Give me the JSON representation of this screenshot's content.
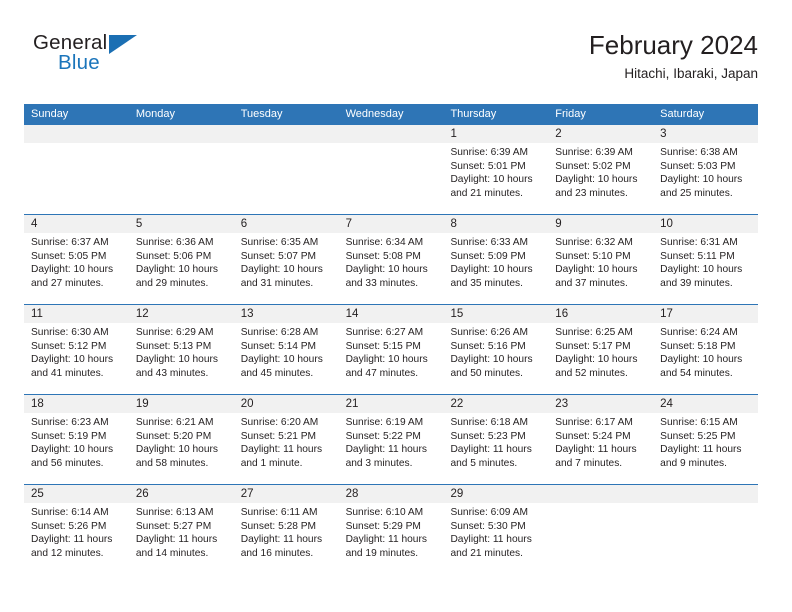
{
  "brand": {
    "name_part1": "General",
    "name_part2": "Blue"
  },
  "header": {
    "title": "February 2024",
    "location": "Hitachi, Ibaraki, Japan"
  },
  "colors": {
    "header_blue": "#2e75b6",
    "brand_blue": "#1b75bb",
    "numrow_gray": "#f1f1f1",
    "text": "#231f20"
  },
  "weekdays": [
    "Sunday",
    "Monday",
    "Tuesday",
    "Wednesday",
    "Thursday",
    "Friday",
    "Saturday"
  ],
  "weeks": [
    {
      "days": [
        {
          "num": "",
          "lines": [
            "",
            "",
            "",
            ""
          ]
        },
        {
          "num": "",
          "lines": [
            "",
            "",
            "",
            ""
          ]
        },
        {
          "num": "",
          "lines": [
            "",
            "",
            "",
            ""
          ]
        },
        {
          "num": "",
          "lines": [
            "",
            "",
            "",
            ""
          ]
        },
        {
          "num": "1",
          "lines": [
            "Sunrise: 6:39 AM",
            "Sunset: 5:01 PM",
            "Daylight: 10 hours",
            "and 21 minutes."
          ]
        },
        {
          "num": "2",
          "lines": [
            "Sunrise: 6:39 AM",
            "Sunset: 5:02 PM",
            "Daylight: 10 hours",
            "and 23 minutes."
          ]
        },
        {
          "num": "3",
          "lines": [
            "Sunrise: 6:38 AM",
            "Sunset: 5:03 PM",
            "Daylight: 10 hours",
            "and 25 minutes."
          ]
        }
      ]
    },
    {
      "days": [
        {
          "num": "4",
          "lines": [
            "Sunrise: 6:37 AM",
            "Sunset: 5:05 PM",
            "Daylight: 10 hours",
            "and 27 minutes."
          ]
        },
        {
          "num": "5",
          "lines": [
            "Sunrise: 6:36 AM",
            "Sunset: 5:06 PM",
            "Daylight: 10 hours",
            "and 29 minutes."
          ]
        },
        {
          "num": "6",
          "lines": [
            "Sunrise: 6:35 AM",
            "Sunset: 5:07 PM",
            "Daylight: 10 hours",
            "and 31 minutes."
          ]
        },
        {
          "num": "7",
          "lines": [
            "Sunrise: 6:34 AM",
            "Sunset: 5:08 PM",
            "Daylight: 10 hours",
            "and 33 minutes."
          ]
        },
        {
          "num": "8",
          "lines": [
            "Sunrise: 6:33 AM",
            "Sunset: 5:09 PM",
            "Daylight: 10 hours",
            "and 35 minutes."
          ]
        },
        {
          "num": "9",
          "lines": [
            "Sunrise: 6:32 AM",
            "Sunset: 5:10 PM",
            "Daylight: 10 hours",
            "and 37 minutes."
          ]
        },
        {
          "num": "10",
          "lines": [
            "Sunrise: 6:31 AM",
            "Sunset: 5:11 PM",
            "Daylight: 10 hours",
            "and 39 minutes."
          ]
        }
      ]
    },
    {
      "days": [
        {
          "num": "11",
          "lines": [
            "Sunrise: 6:30 AM",
            "Sunset: 5:12 PM",
            "Daylight: 10 hours",
            "and 41 minutes."
          ]
        },
        {
          "num": "12",
          "lines": [
            "Sunrise: 6:29 AM",
            "Sunset: 5:13 PM",
            "Daylight: 10 hours",
            "and 43 minutes."
          ]
        },
        {
          "num": "13",
          "lines": [
            "Sunrise: 6:28 AM",
            "Sunset: 5:14 PM",
            "Daylight: 10 hours",
            "and 45 minutes."
          ]
        },
        {
          "num": "14",
          "lines": [
            "Sunrise: 6:27 AM",
            "Sunset: 5:15 PM",
            "Daylight: 10 hours",
            "and 47 minutes."
          ]
        },
        {
          "num": "15",
          "lines": [
            "Sunrise: 6:26 AM",
            "Sunset: 5:16 PM",
            "Daylight: 10 hours",
            "and 50 minutes."
          ]
        },
        {
          "num": "16",
          "lines": [
            "Sunrise: 6:25 AM",
            "Sunset: 5:17 PM",
            "Daylight: 10 hours",
            "and 52 minutes."
          ]
        },
        {
          "num": "17",
          "lines": [
            "Sunrise: 6:24 AM",
            "Sunset: 5:18 PM",
            "Daylight: 10 hours",
            "and 54 minutes."
          ]
        }
      ]
    },
    {
      "days": [
        {
          "num": "18",
          "lines": [
            "Sunrise: 6:23 AM",
            "Sunset: 5:19 PM",
            "Daylight: 10 hours",
            "and 56 minutes."
          ]
        },
        {
          "num": "19",
          "lines": [
            "Sunrise: 6:21 AM",
            "Sunset: 5:20 PM",
            "Daylight: 10 hours",
            "and 58 minutes."
          ]
        },
        {
          "num": "20",
          "lines": [
            "Sunrise: 6:20 AM",
            "Sunset: 5:21 PM",
            "Daylight: 11 hours",
            "and 1 minute."
          ]
        },
        {
          "num": "21",
          "lines": [
            "Sunrise: 6:19 AM",
            "Sunset: 5:22 PM",
            "Daylight: 11 hours",
            "and 3 minutes."
          ]
        },
        {
          "num": "22",
          "lines": [
            "Sunrise: 6:18 AM",
            "Sunset: 5:23 PM",
            "Daylight: 11 hours",
            "and 5 minutes."
          ]
        },
        {
          "num": "23",
          "lines": [
            "Sunrise: 6:17 AM",
            "Sunset: 5:24 PM",
            "Daylight: 11 hours",
            "and 7 minutes."
          ]
        },
        {
          "num": "24",
          "lines": [
            "Sunrise: 6:15 AM",
            "Sunset: 5:25 PM",
            "Daylight: 11 hours",
            "and 9 minutes."
          ]
        }
      ]
    },
    {
      "days": [
        {
          "num": "25",
          "lines": [
            "Sunrise: 6:14 AM",
            "Sunset: 5:26 PM",
            "Daylight: 11 hours",
            "and 12 minutes."
          ]
        },
        {
          "num": "26",
          "lines": [
            "Sunrise: 6:13 AM",
            "Sunset: 5:27 PM",
            "Daylight: 11 hours",
            "and 14 minutes."
          ]
        },
        {
          "num": "27",
          "lines": [
            "Sunrise: 6:11 AM",
            "Sunset: 5:28 PM",
            "Daylight: 11 hours",
            "and 16 minutes."
          ]
        },
        {
          "num": "28",
          "lines": [
            "Sunrise: 6:10 AM",
            "Sunset: 5:29 PM",
            "Daylight: 11 hours",
            "and 19 minutes."
          ]
        },
        {
          "num": "29",
          "lines": [
            "Sunrise: 6:09 AM",
            "Sunset: 5:30 PM",
            "Daylight: 11 hours",
            "and 21 minutes."
          ]
        },
        {
          "num": "",
          "lines": [
            "",
            "",
            "",
            ""
          ]
        },
        {
          "num": "",
          "lines": [
            "",
            "",
            "",
            ""
          ]
        }
      ]
    }
  ]
}
